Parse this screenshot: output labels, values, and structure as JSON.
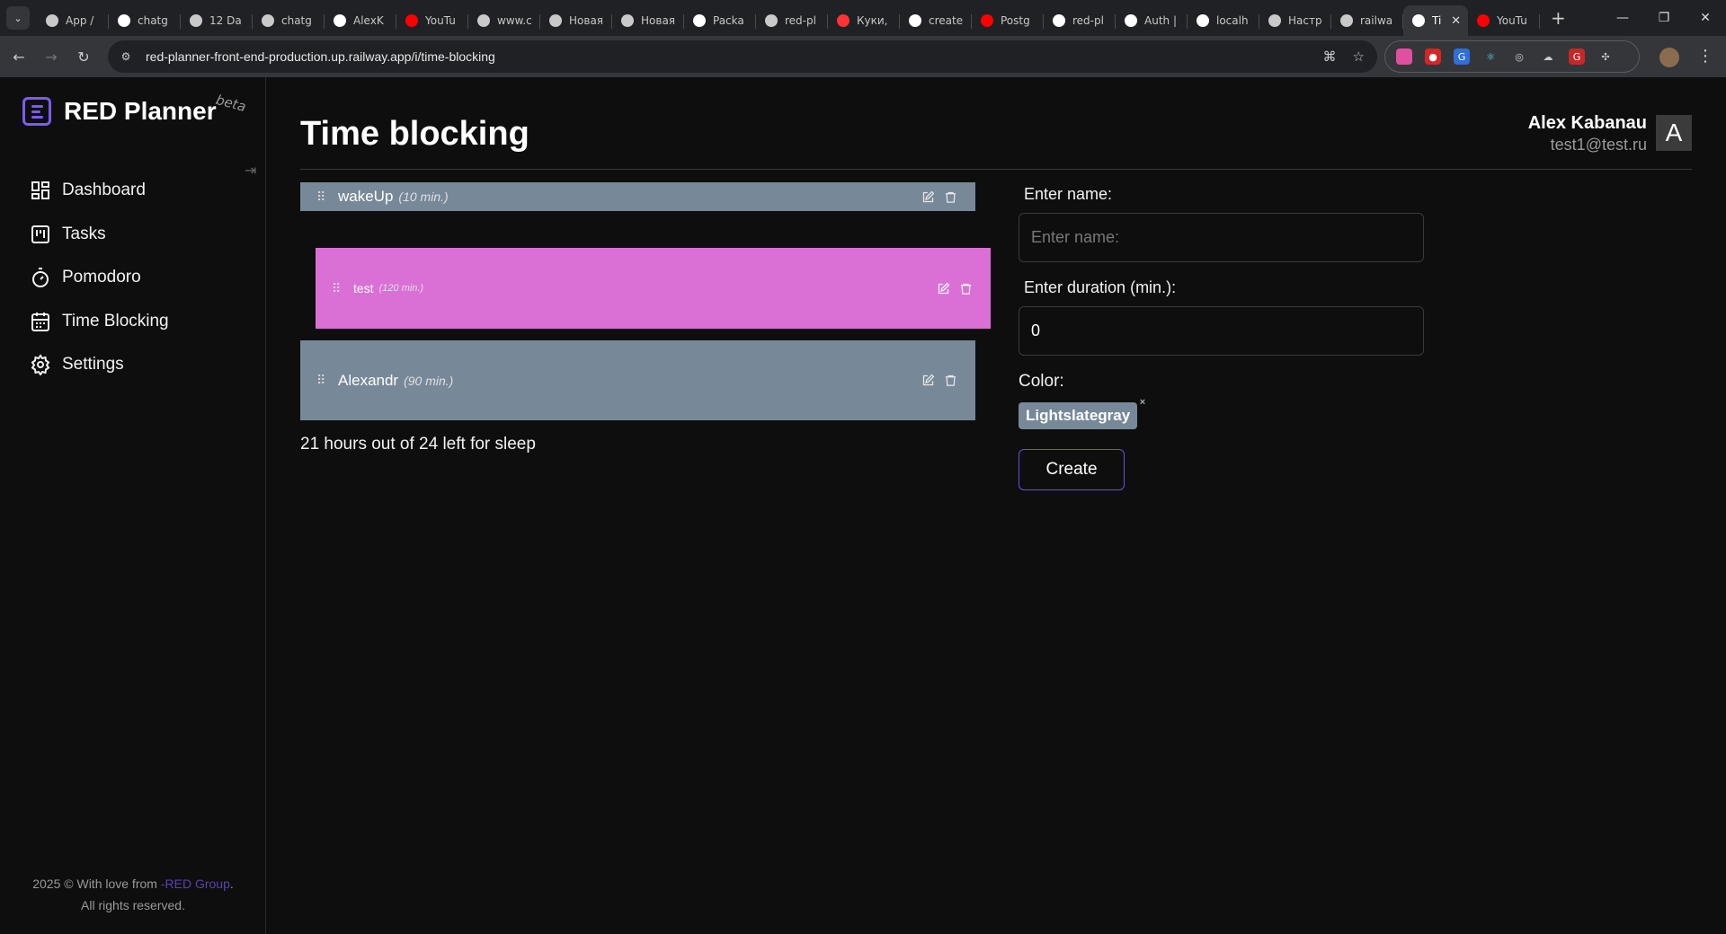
{
  "browser": {
    "tabs": [
      {
        "title": "App /",
        "icon": "globe-icon",
        "color": "#c9c9c9"
      },
      {
        "title": "chatg",
        "icon": "google-icon",
        "color": "#ffffff"
      },
      {
        "title": "12 Da",
        "icon": "openai-icon",
        "color": "#c9c9c9"
      },
      {
        "title": "chatg",
        "icon": "globe-icon",
        "color": "#c9c9c9"
      },
      {
        "title": "AlexK",
        "icon": "github-icon",
        "color": "#ffffff"
      },
      {
        "title": "YouTu",
        "icon": "youtube-icon",
        "color": "#ff0000"
      },
      {
        "title": "www.c",
        "icon": "globe-icon",
        "color": "#c9c9c9"
      },
      {
        "title": "Новая",
        "icon": "chrome-icon",
        "color": "#c9c9c9"
      },
      {
        "title": "Новая",
        "icon": "chrome-icon",
        "color": "#c9c9c9"
      },
      {
        "title": "Packa",
        "icon": "github-icon",
        "color": "#ffffff"
      },
      {
        "title": "red-pl",
        "icon": "globe-icon",
        "color": "#c9c9c9"
      },
      {
        "title": "Куки,",
        "icon": "yandex-icon",
        "color": "#ff3333"
      },
      {
        "title": "create",
        "icon": "google-icon",
        "color": "#ffffff"
      },
      {
        "title": "Postg",
        "icon": "youtube-icon",
        "color": "#ff0000"
      },
      {
        "title": "red-pl",
        "icon": "vercel-icon",
        "color": "#ffffff"
      },
      {
        "title": "Auth |",
        "icon": "vercel-icon",
        "color": "#ffffff"
      },
      {
        "title": "localh",
        "icon": "vercel-icon",
        "color": "#ffffff"
      },
      {
        "title": "Настр",
        "icon": "gear-icon",
        "color": "#c9c9c9"
      },
      {
        "title": "railwa",
        "icon": "railway-icon",
        "color": "#c9c9c9"
      },
      {
        "title": "Ti",
        "icon": "vercel-icon",
        "color": "#ffffff",
        "active": true
      },
      {
        "title": "YouTu",
        "icon": "youtube-icon",
        "color": "#ff0000"
      }
    ],
    "url": "red-planner-front-end-production.up.railway.app/i/time-blocking"
  },
  "sidebar": {
    "logo_text": "RED Planner",
    "beta_label": "beta",
    "items": [
      {
        "label": "Dashboard",
        "icon": "dashboard-icon"
      },
      {
        "label": "Tasks",
        "icon": "kanban-icon"
      },
      {
        "label": "Pomodoro",
        "icon": "timer-icon"
      },
      {
        "label": "Time Blocking",
        "icon": "calendar-icon"
      },
      {
        "label": "Settings",
        "icon": "gear-icon"
      }
    ],
    "footer_line1_prefix": "2025 © With love from ",
    "footer_brand": "-RED Group",
    "footer_line1_suffix": ".",
    "footer_line2": "All rights reserved."
  },
  "header": {
    "title": "Time blocking",
    "user_name": "Alex Kabanau",
    "user_email": "test1@test.ru",
    "avatar_letter": "A"
  },
  "blocks": [
    {
      "name": "wakeUp",
      "duration": "(10 min.)",
      "color": "#778899"
    },
    {
      "name": "test",
      "duration": "(120 min.)",
      "color": "#da70d6"
    },
    {
      "name": "Alexandr",
      "duration": "(90 min.)",
      "color": "#778899"
    }
  ],
  "hours_left_text": "21 hours out of 24 left for sleep",
  "form": {
    "name_label": "Enter name:",
    "name_placeholder": "Enter name:",
    "name_value": "",
    "duration_label": "Enter duration (min.):",
    "duration_value": "0",
    "color_label": "Color:",
    "color_value": "Lightslategray",
    "color_hex": "#778899",
    "chip_remove": "×",
    "create_label": "Create"
  }
}
